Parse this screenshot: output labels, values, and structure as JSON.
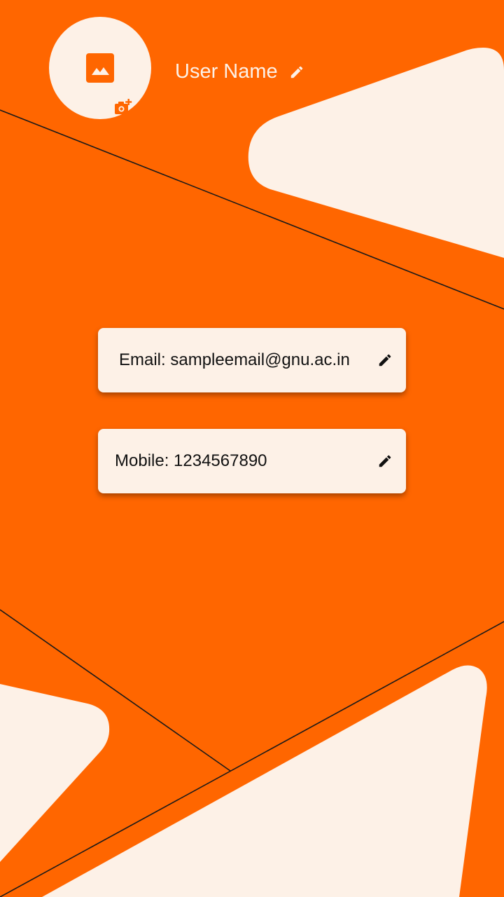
{
  "profile": {
    "user_name": "User Name"
  },
  "contact": {
    "email_label": "Email: sampleemail@gnu.ac.in",
    "mobile_label": "Mobile: 1234567890"
  },
  "icons": {
    "avatar_placeholder": "image-icon",
    "change_photo": "add-photo-camera-icon",
    "edit": "pencil-edit-icon"
  },
  "colors": {
    "background": "#FF6600",
    "surface": "#FDF1E7",
    "text_dark": "#111111",
    "line": "#1a1a1a"
  }
}
